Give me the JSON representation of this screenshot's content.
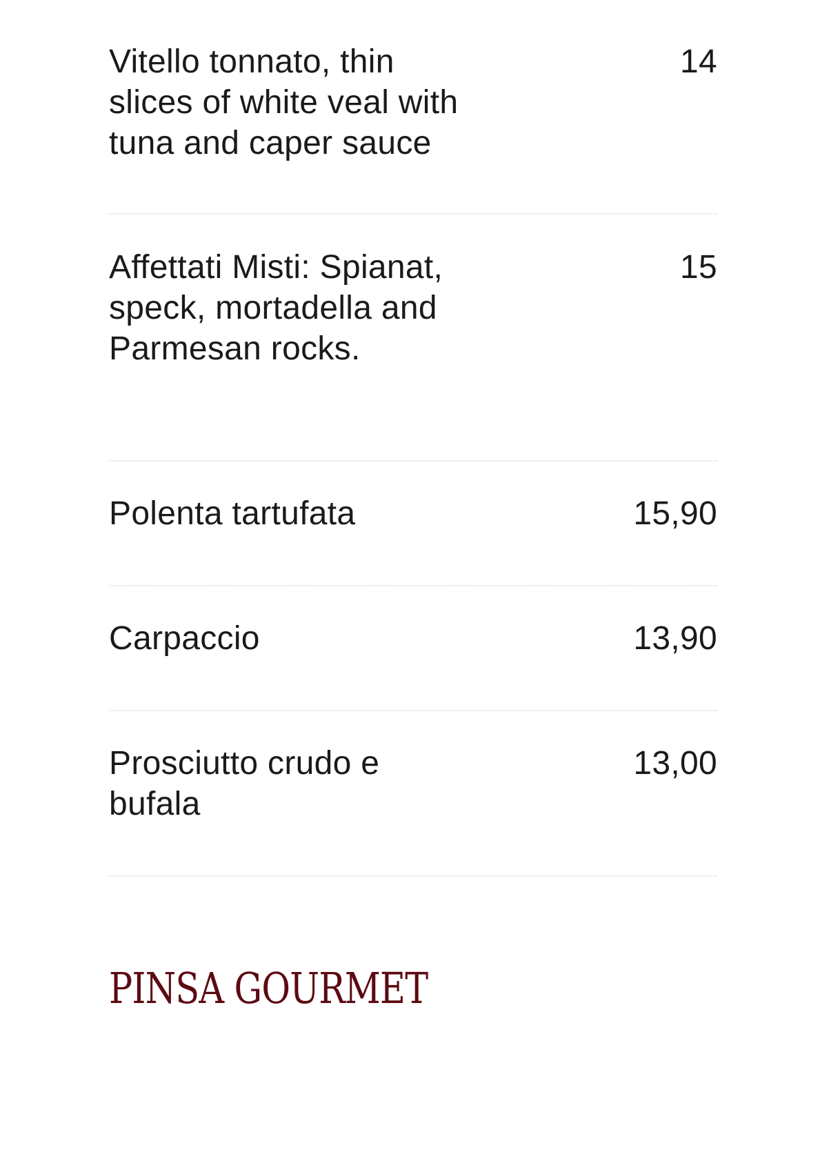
{
  "menu": {
    "items": [
      {
        "name": "Vitello tonnato, thin slices of white veal with tuna and caper sauce",
        "price": "14"
      },
      {
        "name": "Affettati Misti: Spianat, speck, mortadella and Parmesan rocks.",
        "price": "15"
      },
      {
        "name": "Polenta tartufata",
        "price": "15,90"
      },
      {
        "name": "Carpaccio",
        "price": "13,90"
      },
      {
        "name": "Prosciutto crudo e bufala",
        "price": "13,00"
      }
    ]
  },
  "brand": {
    "text": "PINSA GOURMET",
    "color": "#5c0a12"
  }
}
